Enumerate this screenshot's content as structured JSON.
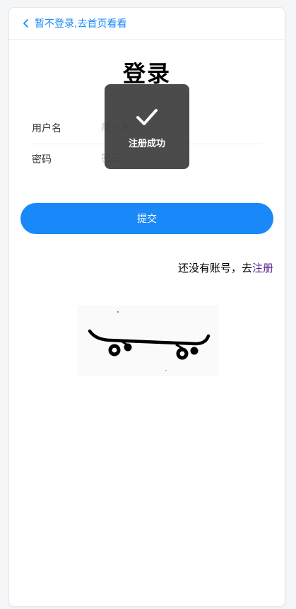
{
  "nav": {
    "back_label": "暂不登录,去首页看看"
  },
  "page": {
    "title": "登录"
  },
  "form": {
    "username_label": "用户名",
    "username_placeholder": "用户名",
    "password_label": "密码",
    "password_placeholder": "密码",
    "submit_label": "提交"
  },
  "register": {
    "prompt": "还没有账号，去",
    "link_label": "注册"
  },
  "toast": {
    "icon": "check-icon",
    "message": "注册成功"
  },
  "colors": {
    "primary": "#1989fa",
    "toast_bg": "#323232",
    "link_visited": "#551a8b"
  }
}
